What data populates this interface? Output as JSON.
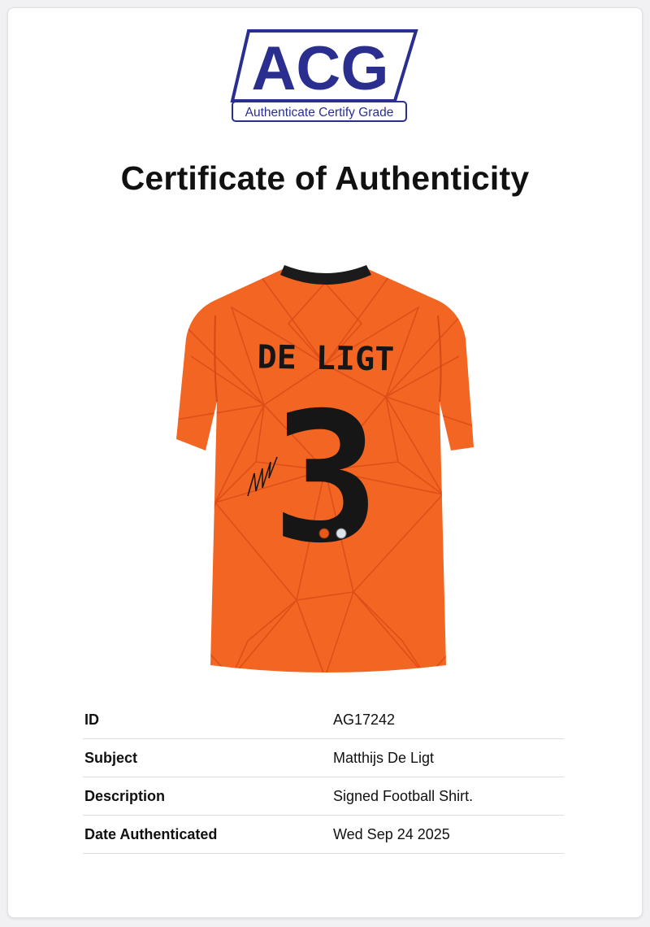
{
  "logo": {
    "brand": "ACG",
    "tagline": "Authenticate Certify Grade",
    "color": "#2a2f8f"
  },
  "title": "Certificate of Authenticity",
  "item_image": {
    "name_print": "DE LIGT",
    "number_print": "3",
    "shirt_color": "#f26522"
  },
  "details": [
    {
      "label": "ID",
      "value": "AG17242"
    },
    {
      "label": "Subject",
      "value": "Matthijs De Ligt"
    },
    {
      "label": "Description",
      "value": "Signed Football Shirt."
    },
    {
      "label": "Date Authenticated",
      "value": "Wed Sep 24 2025"
    }
  ]
}
